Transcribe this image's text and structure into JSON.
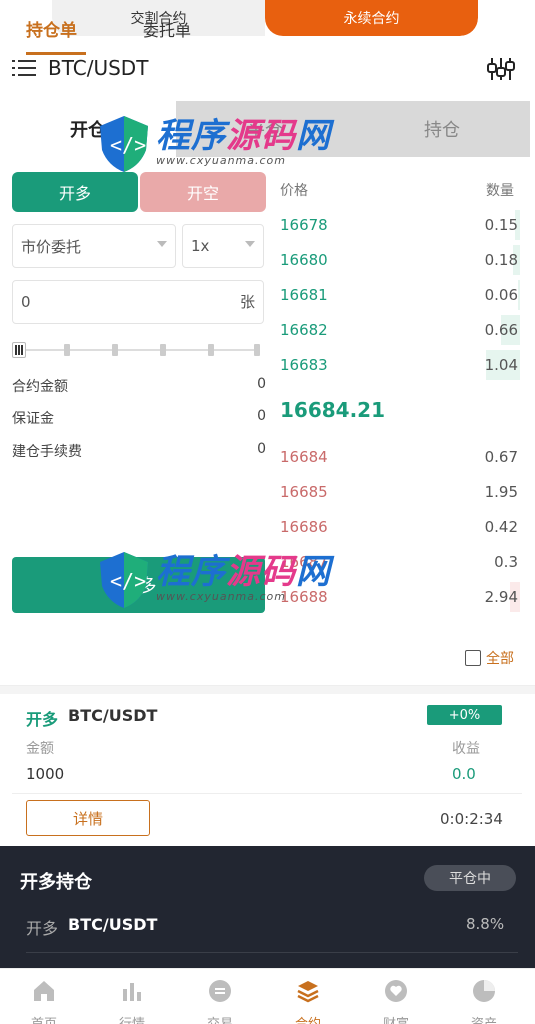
{
  "top_switch": {
    "left": "交割合约",
    "right": "永续合约"
  },
  "header": {
    "pair": "BTC/USDT"
  },
  "tabs": [
    "开仓",
    "平仓",
    "持仓"
  ],
  "trade": {
    "long_label": "开多",
    "short_label": "开空",
    "order_type": "市价委托",
    "leverage": "1x",
    "qty_value": "0",
    "qty_unit": "张",
    "info": [
      {
        "label": "合约金额",
        "value": "0"
      },
      {
        "label": "保证金",
        "value": "0"
      },
      {
        "label": "建仓手续费",
        "value": "0"
      }
    ],
    "submit_label": "开多"
  },
  "order_book": {
    "price_header": "价格",
    "qty_header": "数量",
    "buys": [
      {
        "price": "16678",
        "qty": "0.15",
        "depth": 0.02
      },
      {
        "price": "16680",
        "qty": "0.18",
        "depth": 0.03
      },
      {
        "price": "16681",
        "qty": "0.06",
        "depth": 0.01
      },
      {
        "price": "16682",
        "qty": "0.66",
        "depth": 0.08
      },
      {
        "price": "16683",
        "qty": "1.04",
        "depth": 0.14
      }
    ],
    "last_price": "16684.21",
    "sells": [
      {
        "price": "16684",
        "qty": "0.67",
        "depth": 0.0
      },
      {
        "price": "16685",
        "qty": "1.95",
        "depth": 0.0
      },
      {
        "price": "16686",
        "qty": "0.42",
        "depth": 0.0
      },
      {
        "price": "16687",
        "qty": "0.3",
        "depth": 0.0
      },
      {
        "price": "16688",
        "qty": "2.94",
        "depth": 0.04
      }
    ]
  },
  "positions": {
    "tab_positions": "持仓单",
    "tab_orders": "委托单",
    "all_label": "全部",
    "item": {
      "side": "开多",
      "pair": "BTC/USDT",
      "badge": "+0%",
      "amount_label": "金额",
      "pnl_label": "收益",
      "amount": "1000",
      "pnl": "0.0",
      "detail_label": "详情",
      "time": "0:0:2:34"
    }
  },
  "popup": {
    "title": "开多持仓",
    "pill": "平仓中",
    "side": "开多",
    "pair": "BTC/USDT",
    "pct": "8.8%"
  },
  "nav": [
    "首页",
    "行情",
    "交易",
    "合约",
    "财富",
    "资产"
  ],
  "watermark": {
    "name": "程序源码网",
    "url": "www.cxyuanma.com"
  },
  "colors": {
    "green": "#1a9b7a",
    "orange": "#e8600f",
    "accent": "#c8701e",
    "red": "#c96a6a"
  }
}
